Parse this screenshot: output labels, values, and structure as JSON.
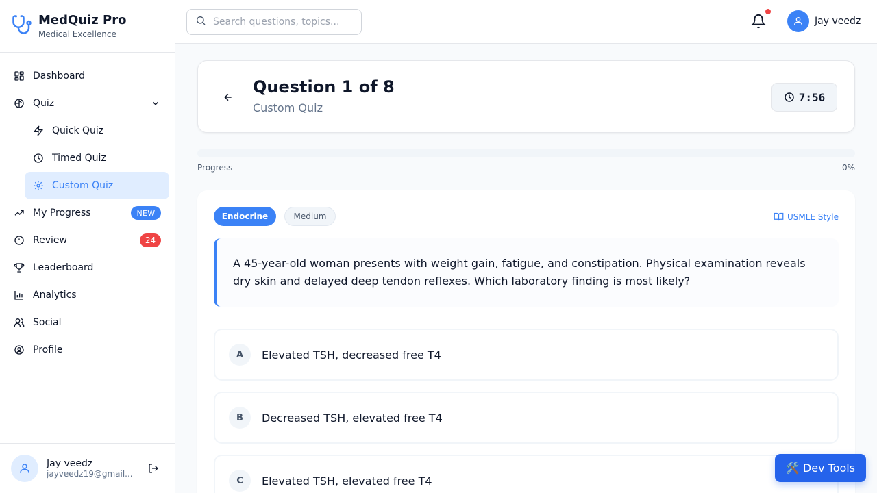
{
  "brand": {
    "name": "MedQuiz Pro",
    "tagline": "Medical Excellence"
  },
  "nav": {
    "dashboard": "Dashboard",
    "quiz": "Quiz",
    "quick_quiz": "Quick Quiz",
    "timed_quiz": "Timed Quiz",
    "custom_quiz": "Custom Quiz",
    "my_progress": "My Progress",
    "my_progress_badge": "NEW",
    "review": "Review",
    "review_count": "24",
    "leaderboard": "Leaderboard",
    "analytics": "Analytics",
    "social": "Social",
    "profile": "Profile"
  },
  "sidebar_user": {
    "name": "Jay veedz",
    "email": "jayveedz19@gmail..."
  },
  "header": {
    "search_placeholder": "Search questions, topics...",
    "user_name": "Jay veedz"
  },
  "quiz": {
    "title": "Question 1 of 8",
    "subtitle": "Custom Quiz",
    "timer": "7:56",
    "progress_label": "Progress",
    "progress_percent": "0%",
    "progress_value": 0
  },
  "question": {
    "category": "Endocrine",
    "difficulty": "Medium",
    "style_label": "USMLE Style",
    "stem": "A 45-year-old woman presents with weight gain, fatigue, and constipation. Physical examination reveals dry skin and delayed deep tendon reflexes. Which laboratory finding is most likely?",
    "options": [
      {
        "letter": "A",
        "text": "Elevated TSH, decreased free T4"
      },
      {
        "letter": "B",
        "text": "Decreased TSH, elevated free T4"
      },
      {
        "letter": "C",
        "text": "Elevated TSH, elevated free T4"
      }
    ]
  },
  "dev_tools": {
    "label": "🛠️ Dev Tools"
  },
  "colors": {
    "accent": "#3b82f6",
    "danger": "#ef4444",
    "active_bg": "#e0edff"
  }
}
